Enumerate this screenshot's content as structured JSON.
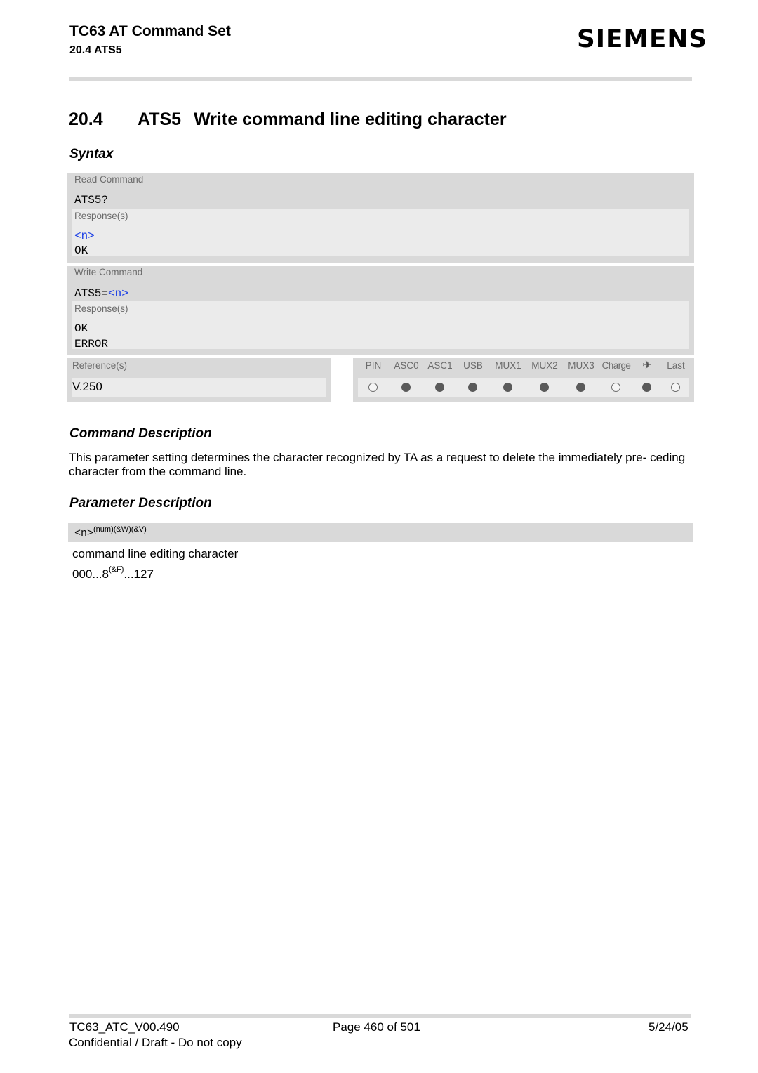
{
  "header": {
    "doc_title": "TC63 AT Command Set",
    "doc_subtitle": "20.4 ATS5",
    "logo": "SIEMENS"
  },
  "section": {
    "number": "20.4",
    "command": "ATS5",
    "title": "Write command line editing character"
  },
  "syntax": {
    "heading": "Syntax",
    "read": {
      "label": "Read Command",
      "command": "ATS5?",
      "responses_label": "Response(s)",
      "responses": [
        "<n>",
        "OK"
      ]
    },
    "write": {
      "label": "Write Command",
      "command_prefix": "ATS5=",
      "command_param": "<n>",
      "responses_label": "Response(s)",
      "responses": [
        "OK",
        "ERROR"
      ]
    },
    "references": {
      "label": "Reference(s)",
      "value": "V.250"
    },
    "availability": [
      {
        "label": "PIN",
        "supported": false
      },
      {
        "label": "ASC0",
        "supported": true
      },
      {
        "label": "ASC1",
        "supported": true
      },
      {
        "label": "USB",
        "supported": true
      },
      {
        "label": "MUX1",
        "supported": true
      },
      {
        "label": "MUX2",
        "supported": true
      },
      {
        "label": "MUX3",
        "supported": true
      },
      {
        "label": "Charge",
        "supported": false
      },
      {
        "label": "airplane-icon",
        "icon": "✈",
        "supported": true
      },
      {
        "label": "Last",
        "supported": false
      }
    ]
  },
  "command_description": {
    "heading": "Command Description",
    "text": "This parameter setting determines the character recognized by TA as a request to delete the immediately pre- ceding character from the command line."
  },
  "parameter_description": {
    "heading": "Parameter Description",
    "param_name": "<n>",
    "param_attrs": "(num)(&W)(&V)",
    "param_text": "command line editing character",
    "range_start": "000...8",
    "range_default_marker": "(&F)",
    "range_end": "...127"
  },
  "footer": {
    "doc_id": "TC63_ATC_V00.490",
    "page": "Page 460 of 501",
    "date": "5/24/05",
    "confidentiality": "Confidential / Draft - Do not copy"
  }
}
